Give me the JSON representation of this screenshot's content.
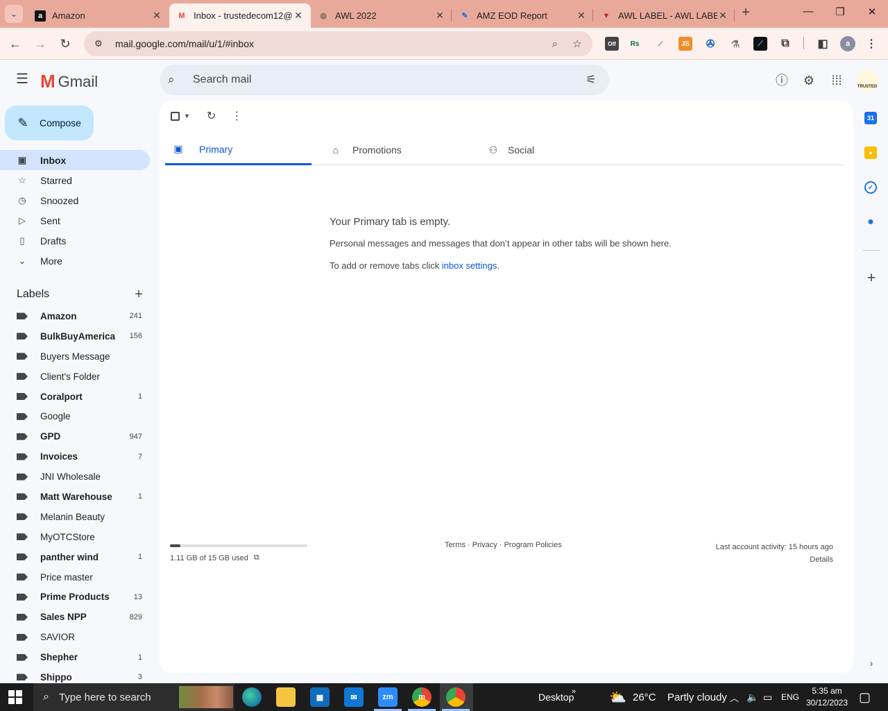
{
  "browser": {
    "tabs": [
      {
        "title": "Amazon",
        "icon": "amazon-favicon",
        "glyph": "a"
      },
      {
        "title": "Inbox - trustedecom12@",
        "icon": "gmail-favicon",
        "glyph": "M"
      },
      {
        "title": "AWL 2022",
        "icon": "globe-favicon",
        "glyph": "◍"
      },
      {
        "title": "AMZ EOD Report",
        "icon": "edit-favicon",
        "glyph": "✎"
      },
      {
        "title": "AWL LABEL - AWL LABEL",
        "icon": "awl-favicon",
        "glyph": "▼"
      }
    ],
    "url": "mail.google.com/mail/u/1/#inbox",
    "extension_badges": [
      "Off",
      "Rs",
      "JS"
    ],
    "profile_initial": "a"
  },
  "gmail": {
    "product_name": "Gmail",
    "compose_label": "Compose",
    "search_placeholder": "Search mail",
    "account_badge": "TRUSTED",
    "nav": [
      {
        "label": "Inbox",
        "icon": "inbox-icon",
        "glyph": "▣"
      },
      {
        "label": "Starred",
        "icon": "star-icon",
        "glyph": "☆"
      },
      {
        "label": "Snoozed",
        "icon": "clock-icon",
        "glyph": "◷"
      },
      {
        "label": "Sent",
        "icon": "send-icon",
        "glyph": "▷"
      },
      {
        "label": "Drafts",
        "icon": "draft-icon",
        "glyph": "▯"
      },
      {
        "label": "More",
        "icon": "chevron-down-icon",
        "glyph": "⌄"
      }
    ],
    "labels_heading": "Labels",
    "labels": [
      {
        "name": "Amazon",
        "count": "241",
        "unread": true
      },
      {
        "name": "BulkBuyAmerica",
        "count": "156",
        "unread": true
      },
      {
        "name": "Buyers Message",
        "count": "",
        "unread": false
      },
      {
        "name": "Client's Folder",
        "count": "",
        "unread": false
      },
      {
        "name": "Coralport",
        "count": "1",
        "unread": true
      },
      {
        "name": "Google",
        "count": "",
        "unread": false
      },
      {
        "name": "GPD",
        "count": "947",
        "unread": true
      },
      {
        "name": "Invoices",
        "count": "7",
        "unread": true
      },
      {
        "name": "JNI Wholesale",
        "count": "",
        "unread": false
      },
      {
        "name": "Matt Warehouse",
        "count": "1",
        "unread": true
      },
      {
        "name": "Melanin Beauty",
        "count": "",
        "unread": false
      },
      {
        "name": "MyOTCStore",
        "count": "",
        "unread": false
      },
      {
        "name": "panther wind",
        "count": "1",
        "unread": true
      },
      {
        "name": "Price master",
        "count": "",
        "unread": false
      },
      {
        "name": "Prime Products",
        "count": "13",
        "unread": true
      },
      {
        "name": "Sales NPP",
        "count": "829",
        "unread": true
      },
      {
        "name": "SAVIOR",
        "count": "",
        "unread": false
      },
      {
        "name": "Shepher",
        "count": "1",
        "unread": true
      },
      {
        "name": "Shippo",
        "count": "3",
        "unread": true
      }
    ],
    "inbox_tabs": [
      {
        "label": "Primary",
        "icon": "inbox-icon",
        "glyph": "▣"
      },
      {
        "label": "Promotions",
        "icon": "tag-icon",
        "glyph": "⌂"
      },
      {
        "label": "Social",
        "icon": "people-icon",
        "glyph": "⚇"
      }
    ],
    "empty_state": {
      "heading": "Your Primary tab is empty.",
      "line1": "Personal messages and messages that don’t appear in other tabs will be shown here.",
      "line2_prefix": "To add or remove tabs click ",
      "line2_link": "inbox settings",
      "line2_suffix": "."
    },
    "footer": {
      "storage_text": "1.11 GB of 15 GB used",
      "storage_fraction": 0.074,
      "terms": "Terms",
      "privacy": "Privacy",
      "program_policies": "Program Policies",
      "separator": " · ",
      "last_activity": "Last account activity: 15 hours ago",
      "details": "Details"
    },
    "side_panel": {
      "calendar_day": "31"
    }
  },
  "taskbar": {
    "search_placeholder": "Type here to search",
    "desktop_label": "Desktop",
    "weather_temp": "26°C",
    "weather_text": "Partly cloudy",
    "language": "ENG",
    "time": "5:35 am",
    "date": "30/12/2023",
    "app_badges": [
      "zm",
      "m"
    ]
  },
  "colors": {
    "tab_strip": "#e9a99a",
    "active_tab": "#fdf1ee",
    "compose": "#c2e7ff",
    "active_nav": "#d3e3fd",
    "accent": "#0b57d0",
    "taskbar": "#1c1c1c"
  }
}
